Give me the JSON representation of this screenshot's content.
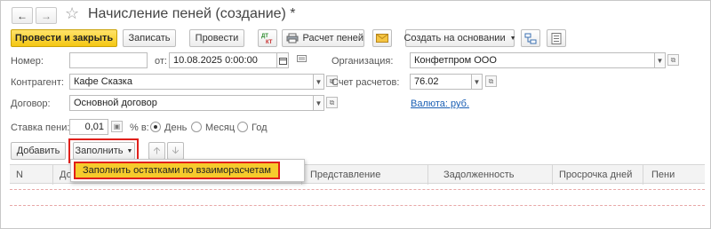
{
  "window": {
    "title": "Начисление пеней (создание) *"
  },
  "toolbar": {
    "post_close": "Провести и закрыть",
    "save": "Записать",
    "post": "Провести",
    "calc": "Расчет пеней",
    "create_based": "Создать на основании"
  },
  "form": {
    "number_label": "Номер:",
    "number_value": "",
    "date_label": "от:",
    "date_value": "10.08.2025  0:00:00",
    "org_label": "Организация:",
    "org_value": "Конфетпром ООО",
    "counterparty_label": "Контрагент:",
    "counterparty_value": "Кафе Сказка",
    "account_label": "Счет расчетов:",
    "account_value": "76.02",
    "contract_label": "Договор:",
    "contract_value": "Основной договор",
    "currency_link": "Валюта: руб.",
    "rate_label": "Ставка пени:",
    "rate_value": "0,01",
    "percent_label": "% в:",
    "period_options": [
      "День",
      "Месяц",
      "Год"
    ],
    "period_selected": "День"
  },
  "tablebar": {
    "add": "Добавить",
    "fill": "Заполнить"
  },
  "table": {
    "columns": [
      "N",
      "До",
      "Представление",
      "Задолженность",
      "Просрочка дней",
      "Пени"
    ]
  },
  "fill_menu": {
    "item": "Заполнить остатками по взаиморасчетам"
  }
}
